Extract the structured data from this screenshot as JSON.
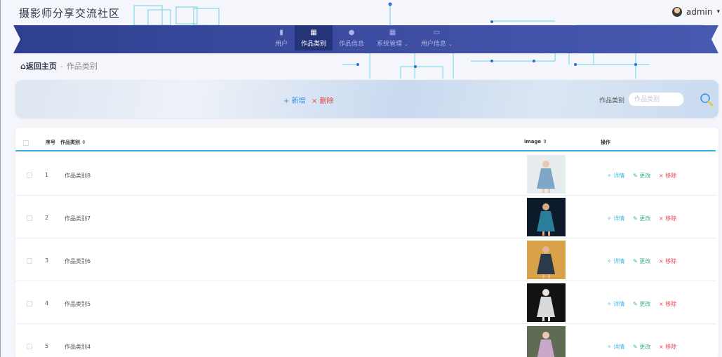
{
  "header": {
    "site_title": "摄影师分享交流社区",
    "user_name": "admin"
  },
  "nav": [
    {
      "icon": "bar-chart-icon",
      "glyph": "▮",
      "label": "用户",
      "active": false,
      "dropdown": false
    },
    {
      "icon": "grid-icon",
      "glyph": "▦",
      "label": "作品类别",
      "active": true,
      "dropdown": false
    },
    {
      "icon": "person-icon",
      "glyph": "●",
      "label": "作品信息",
      "active": false,
      "dropdown": false
    },
    {
      "icon": "grid-icon",
      "glyph": "▦",
      "label": "系统管理",
      "active": false,
      "dropdown": true
    },
    {
      "icon": "calendar-icon",
      "glyph": "▭",
      "label": "用户信息",
      "active": false,
      "dropdown": true
    }
  ],
  "breadcrumb": {
    "home": "返回主页",
    "separator": "-",
    "current": "作品类别"
  },
  "toolbar": {
    "add_label": "+ 新增",
    "delete_label": "× 删除",
    "search_label": "作品类别",
    "search_placeholder": "作品类别",
    "search_value": ""
  },
  "table": {
    "headers": {
      "index": "序号",
      "category": "作品类别 ⇳",
      "image": "image ⇳",
      "actions": "操作"
    },
    "action_labels": {
      "detail": "✧ 详情",
      "edit": "✎ 更改",
      "remove": "× 移除"
    },
    "rows": [
      {
        "index": "1",
        "category": "作品类别8",
        "photo_bg": "#e7ecef",
        "figure": "#7fa6c6",
        "skin": "#e9c8ad"
      },
      {
        "index": "2",
        "category": "作品类别7",
        "photo_bg": "#0c1a2a",
        "figure": "#2b7d9c",
        "skin": "#d8a88a"
      },
      {
        "index": "3",
        "category": "作品类别6",
        "photo_bg": "#d9a24a",
        "figure": "#2a3a4a",
        "skin": "#e4b690"
      },
      {
        "index": "4",
        "category": "作品类别5",
        "photo_bg": "#121212",
        "figure": "#d9d9d9",
        "skin": "#ece2da"
      },
      {
        "index": "5",
        "category": "作品类别4",
        "photo_bg": "#5f6b53",
        "figure": "#c8a7c9",
        "skin": "#e9c8b8"
      }
    ]
  },
  "colors": {
    "nav_bg": "#2f3f8f",
    "nav_active": "#253378",
    "accent_line": "#3bb3e6",
    "danger": "#e5484d",
    "edit": "#3fb58a"
  }
}
